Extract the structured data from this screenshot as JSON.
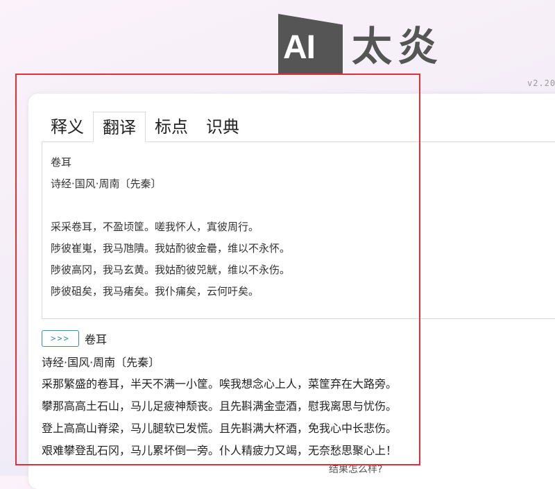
{
  "logo": {
    "ai": "AI",
    "name": "太炎"
  },
  "version": "v2.20",
  "tabs": [
    {
      "label": "释义",
      "active": false
    },
    {
      "label": "翻译",
      "active": true
    },
    {
      "label": "标点",
      "active": false
    },
    {
      "label": "识典",
      "active": false
    }
  ],
  "input": {
    "lines": [
      "卷耳",
      "诗经·国风·周南〔先秦〕",
      "",
      "采采卷耳，不盈顷筐。嗟我怀人，寘彼周行。",
      "陟彼崔嵬，我马虺隤。我姑酌彼金罍，维以不永怀。",
      "陟彼高冈，我马玄黄。我姑酌彼兕觥，维以不永伤。",
      "陟彼砠矣，我马瘏矣。我仆痡矣，云何吁矣。"
    ]
  },
  "run_button": {
    "label": ">>>"
  },
  "result": {
    "title": "卷耳",
    "meta": "诗经·国风·周南〔先秦〕",
    "lines": [
      "采那繁盛的卷耳，半天不满一小筐。唉我想念心上人，菜筐弃在大路旁。",
      "攀那高高土石山，马儿足疲神颓丧。且先斟满金壶酒，慰我离思与忧伤。",
      "登上高高山脊梁，马儿腿软已发慌。且先斟满大杯酒，免我心中长悲伤。",
      "艰难攀登乱石冈，马儿累坏倒一旁。仆人精疲力又竭，无奈愁思聚心上！"
    ]
  },
  "feedback": {
    "label": "结果怎么样?"
  },
  "colors": {
    "highlight_border": "#e0303a",
    "button_accent": "#3a8f99",
    "logo_gray": "#555555"
  }
}
